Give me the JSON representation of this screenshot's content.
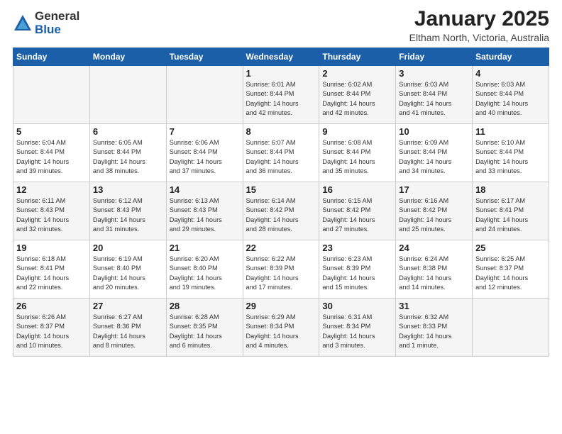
{
  "logo": {
    "general": "General",
    "blue": "Blue"
  },
  "header": {
    "month": "January 2025",
    "location": "Eltham North, Victoria, Australia"
  },
  "days_of_week": [
    "Sunday",
    "Monday",
    "Tuesday",
    "Wednesday",
    "Thursday",
    "Friday",
    "Saturday"
  ],
  "weeks": [
    [
      {
        "day": "",
        "info": ""
      },
      {
        "day": "",
        "info": ""
      },
      {
        "day": "",
        "info": ""
      },
      {
        "day": "1",
        "info": "Sunrise: 6:01 AM\nSunset: 8:44 PM\nDaylight: 14 hours\nand 42 minutes."
      },
      {
        "day": "2",
        "info": "Sunrise: 6:02 AM\nSunset: 8:44 PM\nDaylight: 14 hours\nand 42 minutes."
      },
      {
        "day": "3",
        "info": "Sunrise: 6:03 AM\nSunset: 8:44 PM\nDaylight: 14 hours\nand 41 minutes."
      },
      {
        "day": "4",
        "info": "Sunrise: 6:03 AM\nSunset: 8:44 PM\nDaylight: 14 hours\nand 40 minutes."
      }
    ],
    [
      {
        "day": "5",
        "info": "Sunrise: 6:04 AM\nSunset: 8:44 PM\nDaylight: 14 hours\nand 39 minutes."
      },
      {
        "day": "6",
        "info": "Sunrise: 6:05 AM\nSunset: 8:44 PM\nDaylight: 14 hours\nand 38 minutes."
      },
      {
        "day": "7",
        "info": "Sunrise: 6:06 AM\nSunset: 8:44 PM\nDaylight: 14 hours\nand 37 minutes."
      },
      {
        "day": "8",
        "info": "Sunrise: 6:07 AM\nSunset: 8:44 PM\nDaylight: 14 hours\nand 36 minutes."
      },
      {
        "day": "9",
        "info": "Sunrise: 6:08 AM\nSunset: 8:44 PM\nDaylight: 14 hours\nand 35 minutes."
      },
      {
        "day": "10",
        "info": "Sunrise: 6:09 AM\nSunset: 8:44 PM\nDaylight: 14 hours\nand 34 minutes."
      },
      {
        "day": "11",
        "info": "Sunrise: 6:10 AM\nSunset: 8:44 PM\nDaylight: 14 hours\nand 33 minutes."
      }
    ],
    [
      {
        "day": "12",
        "info": "Sunrise: 6:11 AM\nSunset: 8:43 PM\nDaylight: 14 hours\nand 32 minutes."
      },
      {
        "day": "13",
        "info": "Sunrise: 6:12 AM\nSunset: 8:43 PM\nDaylight: 14 hours\nand 31 minutes."
      },
      {
        "day": "14",
        "info": "Sunrise: 6:13 AM\nSunset: 8:43 PM\nDaylight: 14 hours\nand 29 minutes."
      },
      {
        "day": "15",
        "info": "Sunrise: 6:14 AM\nSunset: 8:42 PM\nDaylight: 14 hours\nand 28 minutes."
      },
      {
        "day": "16",
        "info": "Sunrise: 6:15 AM\nSunset: 8:42 PM\nDaylight: 14 hours\nand 27 minutes."
      },
      {
        "day": "17",
        "info": "Sunrise: 6:16 AM\nSunset: 8:42 PM\nDaylight: 14 hours\nand 25 minutes."
      },
      {
        "day": "18",
        "info": "Sunrise: 6:17 AM\nSunset: 8:41 PM\nDaylight: 14 hours\nand 24 minutes."
      }
    ],
    [
      {
        "day": "19",
        "info": "Sunrise: 6:18 AM\nSunset: 8:41 PM\nDaylight: 14 hours\nand 22 minutes."
      },
      {
        "day": "20",
        "info": "Sunrise: 6:19 AM\nSunset: 8:40 PM\nDaylight: 14 hours\nand 20 minutes."
      },
      {
        "day": "21",
        "info": "Sunrise: 6:20 AM\nSunset: 8:40 PM\nDaylight: 14 hours\nand 19 minutes."
      },
      {
        "day": "22",
        "info": "Sunrise: 6:22 AM\nSunset: 8:39 PM\nDaylight: 14 hours\nand 17 minutes."
      },
      {
        "day": "23",
        "info": "Sunrise: 6:23 AM\nSunset: 8:39 PM\nDaylight: 14 hours\nand 15 minutes."
      },
      {
        "day": "24",
        "info": "Sunrise: 6:24 AM\nSunset: 8:38 PM\nDaylight: 14 hours\nand 14 minutes."
      },
      {
        "day": "25",
        "info": "Sunrise: 6:25 AM\nSunset: 8:37 PM\nDaylight: 14 hours\nand 12 minutes."
      }
    ],
    [
      {
        "day": "26",
        "info": "Sunrise: 6:26 AM\nSunset: 8:37 PM\nDaylight: 14 hours\nand 10 minutes."
      },
      {
        "day": "27",
        "info": "Sunrise: 6:27 AM\nSunset: 8:36 PM\nDaylight: 14 hours\nand 8 minutes."
      },
      {
        "day": "28",
        "info": "Sunrise: 6:28 AM\nSunset: 8:35 PM\nDaylight: 14 hours\nand 6 minutes."
      },
      {
        "day": "29",
        "info": "Sunrise: 6:29 AM\nSunset: 8:34 PM\nDaylight: 14 hours\nand 4 minutes."
      },
      {
        "day": "30",
        "info": "Sunrise: 6:31 AM\nSunset: 8:34 PM\nDaylight: 14 hours\nand 3 minutes."
      },
      {
        "day": "31",
        "info": "Sunrise: 6:32 AM\nSunset: 8:33 PM\nDaylight: 14 hours\nand 1 minute."
      },
      {
        "day": "",
        "info": ""
      }
    ]
  ]
}
